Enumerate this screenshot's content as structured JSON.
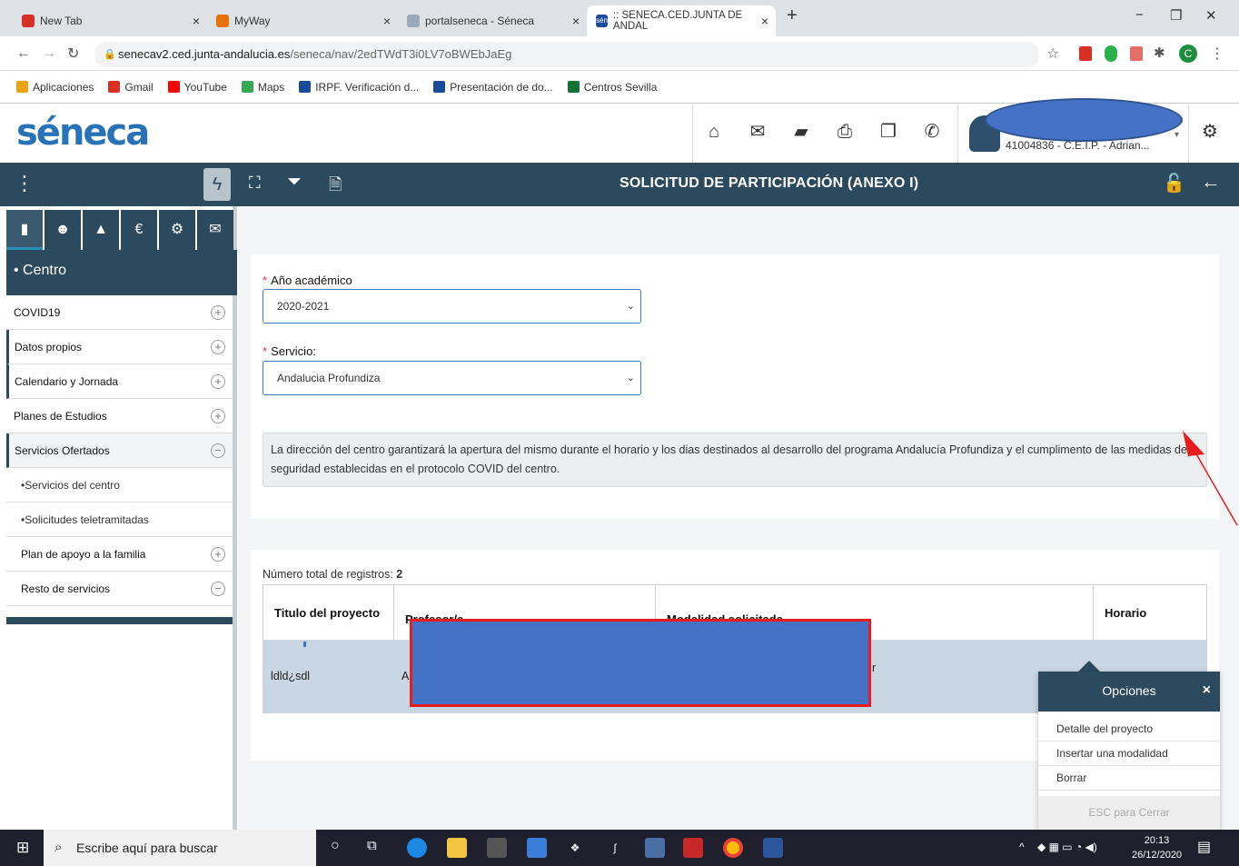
{
  "browser": {
    "tabs": [
      {
        "title": "New Tab",
        "color": "#d93025"
      },
      {
        "title": "MyWay",
        "color": "#e8710a"
      },
      {
        "title": "portalseneca - Séneca",
        "color": "#9ab"
      },
      {
        "title": ":: SENECA.CED.JUNTA DE ANDAL",
        "color": "#1a4a9a"
      }
    ],
    "url_host": "senecav2.ced.junta-andalucia.es",
    "url_path": "/seneca/nav/2edTWdT3i0LV7oBWEbJaEg",
    "bookmarks": [
      {
        "label": "Aplicaciones",
        "color": "#e8a317"
      },
      {
        "label": "Gmail",
        "color": "#d93025"
      },
      {
        "label": "YouTube",
        "color": "#ff0000"
      },
      {
        "label": "Maps",
        "color": "#34a853"
      },
      {
        "label": "IRPF. Verificación d...",
        "color": "#1a4a9a"
      },
      {
        "label": "Presentación de do...",
        "color": "#1a4a9a"
      },
      {
        "label": "Centros Sevilla",
        "color": "#137333"
      }
    ]
  },
  "header": {
    "logo": "séneca",
    "user_line": "41004836 - C.E.I.P. - Adrian..."
  },
  "toolbar": {
    "title": "SOLICITUD DE PARTICIPACIÓN (ANEXO I)"
  },
  "sidebar": {
    "section": "• Centro",
    "items": [
      {
        "label": "COVID19",
        "sign": "+"
      },
      {
        "label": "Datos propios",
        "sign": "+"
      },
      {
        "label": "Calendario y Jornada",
        "sign": "+"
      },
      {
        "label": "Planes de Estudios",
        "sign": "+"
      },
      {
        "label": "Servicios Ofertados",
        "sign": "−"
      },
      {
        "label": "•Servicios del centro",
        "sign": ""
      },
      {
        "label": "•Solicitudes teletramitadas",
        "sign": ""
      },
      {
        "label": "Plan de apoyo a la familia",
        "sign": "+"
      },
      {
        "label": "Resto de servicios",
        "sign": "−"
      }
    ]
  },
  "form": {
    "year_label": "Año académico",
    "year_value": "2020-2021",
    "service_label": "Servicio:",
    "service_value": "Andalucia Profundiza",
    "notice": "La dirección del centro garantizará la apertura del mismo durante el horario y los dias destinados al desarrollo del programa Andalucía Profundiza y el cumplimento de las medidas de seguridad establecidas en el protocolo COVID del centro."
  },
  "table": {
    "total_label": "Número total de registros:",
    "total_value": "2",
    "columns": [
      "Titulo del proyecto",
      "Profesor/a",
      "Modalidad solicitada",
      "Horario"
    ],
    "row": {
      "title": "ldld¿sdl",
      "teacher_prefix": "A",
      "modality_suffix": "r"
    }
  },
  "popup": {
    "title": "Opciones",
    "close": "×",
    "items": [
      "Detalle del proyecto",
      "Insertar una modalidad",
      "Borrar"
    ],
    "footer": "ESC para Cerrar"
  },
  "taskbar": {
    "search_placeholder": "Escribe aquí para buscar",
    "time": "20:13",
    "date": "26/12/2020"
  }
}
